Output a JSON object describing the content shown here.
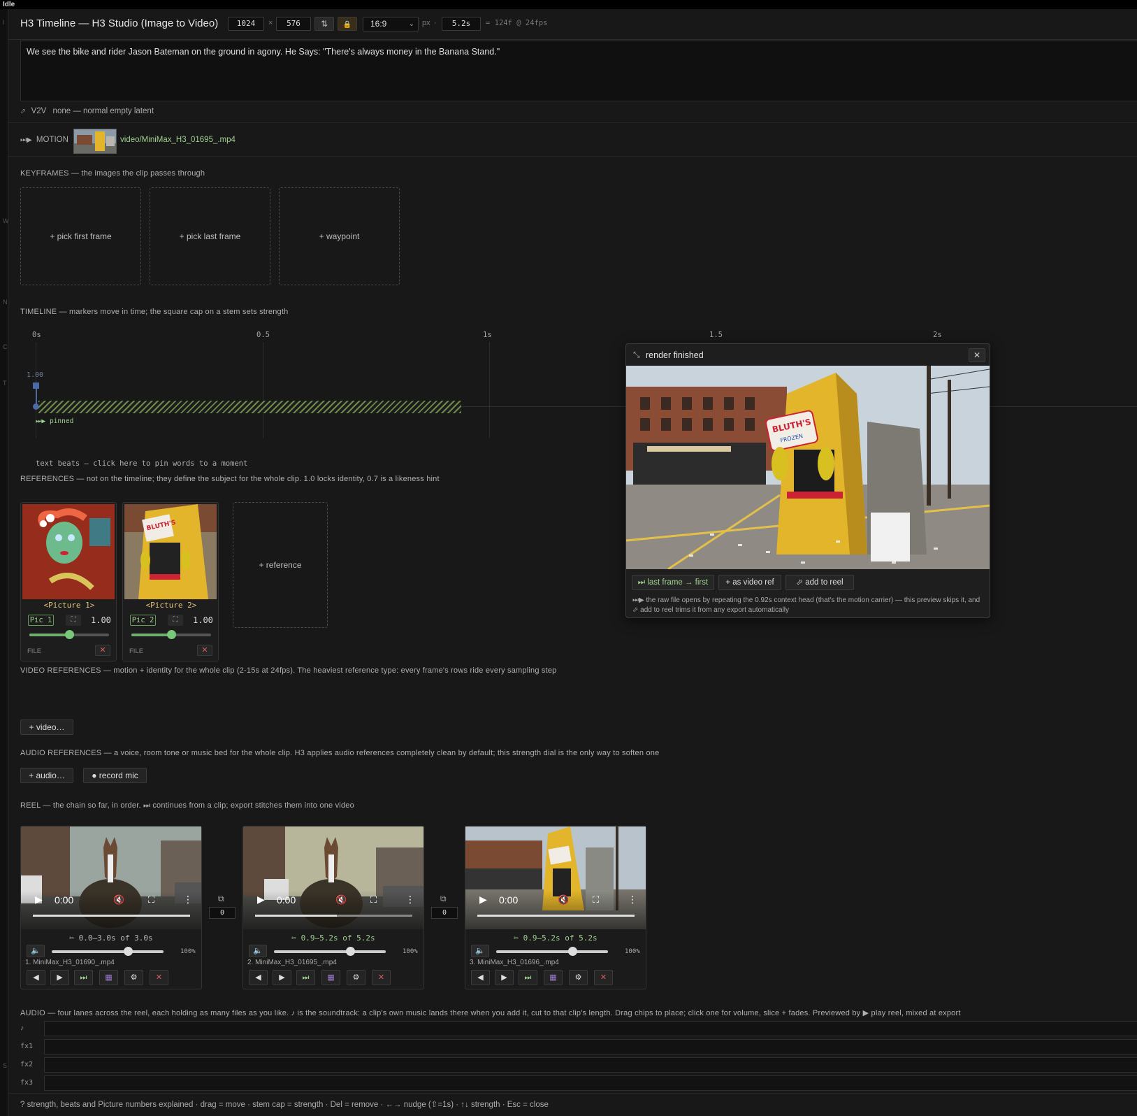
{
  "status": "Idle",
  "gutter_letters": [
    "I",
    "W",
    "N",
    "C",
    "T",
    "S"
  ],
  "header": {
    "title": "H3 Timeline — H3 Studio (Image to Video)",
    "width": "1024",
    "times": "×",
    "height": "576",
    "swap_icon": "⇅",
    "lock_icon": "🔒",
    "aspect": "16:9",
    "px": "px",
    "dot": "·",
    "duration": "5.2s",
    "frames": "= 124f @ 24fps"
  },
  "prompt": "We see the bike and rider Jason Bateman on the ground in agony.  He Says: \"There's always money in the Banana Stand.\"",
  "v2v": {
    "icon": "⬀",
    "label": "V2V",
    "value": "none — normal empty latent"
  },
  "motion": {
    "icon": "⏭▶",
    "label": "MOTION",
    "file": "video/MiniMax_H3_01695_.mp4"
  },
  "keyframes": {
    "label": "KEYFRAMES — the images the clip passes through",
    "slots": [
      "+ pick first frame",
      "+ pick last frame",
      "+ waypoint"
    ]
  },
  "timeline": {
    "label": "TIMELINE — markers move in time; the square cap on a stem sets strength",
    "ticks": [
      "0s",
      "0.5",
      "1s",
      "1.5",
      "2s"
    ],
    "strength": "1.00",
    "pinned": "⏭▶ pinned",
    "beats": "text beats — click here to pin words to a moment"
  },
  "references": {
    "label": "REFERENCES — not on the timeline; they define the subject for the whole clip. 1.0 locks identity, 0.7 is a likeness hint",
    "items": [
      {
        "caption": "<Picture 1>",
        "tag": "Pic 1",
        "value": "1.00",
        "strength": 0.5,
        "file": "FILE"
      },
      {
        "caption": "<Picture 2>",
        "tag": "Pic 2",
        "value": "1.00",
        "strength": 0.5,
        "file": "FILE"
      }
    ],
    "add": "+ reference"
  },
  "video_references": {
    "label": "VIDEO REFERENCES — motion + identity for the whole clip (2-15s at 24fps). The heaviest reference type: every frame's rows ride every sampling step",
    "add": "+ video…"
  },
  "audio_references": {
    "label": "AUDIO REFERENCES — a voice, room tone or music bed for the whole clip. H3 applies audio references completely clean by default; this strength dial is the only way to soften one",
    "add": "+ audio…",
    "record": "● record mic"
  },
  "reel": {
    "label": "REEL — the chain so far, in order. ⏭ continues from a clip; export stitches them into one video",
    "clips": [
      {
        "time": "0:00",
        "trim": "✂ 0.0–3.0s of 3.0s",
        "trim_color": "#b8b8b8",
        "volume": "100%",
        "volume_level": 0.7,
        "name": "1. MiniMax_H3_01690_.mp4",
        "progress": 1.0
      },
      {
        "time": "0:00",
        "trim": "✂ 0.9–5.2s of 5.2s",
        "trim_color": "#9fd18f",
        "volume": "100%",
        "volume_level": 0.7,
        "name": "2. MiniMax_H3_01695_.mp4",
        "progress": 0.52
      },
      {
        "time": "0:00",
        "trim": "✂ 0.9–5.2s of 5.2s",
        "trim_color": "#9fd18f",
        "volume": "100%",
        "volume_level": 0.7,
        "name": "3. MiniMax_H3_01696_.mp4",
        "progress": 1.0
      }
    ],
    "links": [
      {
        "icon": "⧉",
        "value": "0"
      },
      {
        "icon": "⧉",
        "value": "0"
      }
    ]
  },
  "audio": {
    "label": "AUDIO — four lanes across the reel, each holding as many files as you like. ♪ is the soundtrack: a clip's own music lands there when you add it, cut to that clip's length. Drag chips to place; click one for volume, slice + fades. Previewed by ▶ play reel, mixed at export",
    "lanes": [
      "♪",
      "fx1",
      "fx2",
      "fx3"
    ]
  },
  "footer": "? strength, beats and Picture numbers explained · drag = move · stem cap = strength · Del = remove · ←→ nudge (⇧=1s) · ↑↓ strength · Esc = close",
  "popup": {
    "icon": "⤡",
    "title": "render finished",
    "close": "✕",
    "buttons": [
      "⏭ last frame → first",
      "+ as video ref",
      "⬀ add to reel"
    ],
    "note": "⏭▶ the raw file opens by repeating the 0.92s context head (that's the motion carrier) — this preview skips it, and ⬀ add to reel trims it from any export automatically"
  },
  "colors": {
    "accent_green": "#9fd18f",
    "danger": "#d25f5f",
    "banana_yellow": "#e3b52a"
  }
}
